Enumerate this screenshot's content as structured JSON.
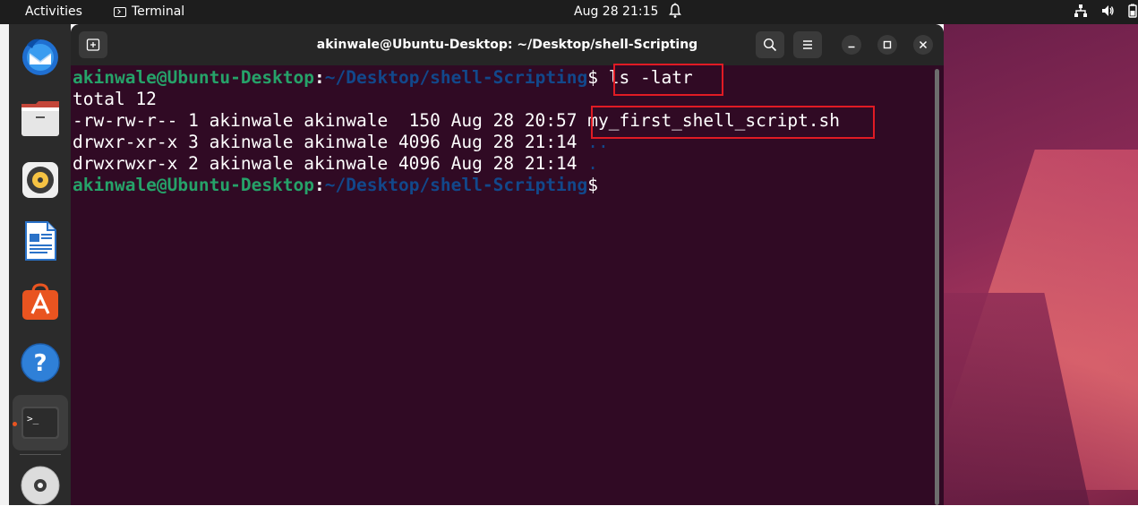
{
  "topbar": {
    "activities": "Activities",
    "app_name": "Terminal",
    "datetime": "Aug 28  21:15"
  },
  "dock": {
    "items": [
      "thunderbird-icon",
      "files-icon",
      "rhythmbox-icon",
      "libreoffice-writer-icon",
      "app-center-icon",
      "help-icon",
      "terminal-icon",
      "disc-icon"
    ],
    "terminal_glyph": ">_"
  },
  "terminal": {
    "title": "akinwale@Ubuntu-Desktop: ~/Desktop/shell-Scripting",
    "prompt_user": "akinwale@Ubuntu-Desktop",
    "prompt_colon": ":",
    "prompt_path": "~/Desktop/shell-Scripting",
    "prompt_dollar": "$",
    "command": " ls -latr",
    "output": {
      "total": "total 12",
      "rows": [
        {
          "meta": "-rw-rw-r-- 1 akinwale akinwale  150 Aug 28 20:57 ",
          "name": "my_first_shell_script.sh"
        },
        {
          "meta": "drwxr-xr-x 3 akinwale akinwale 4096 Aug 28 21:14 ",
          "name": ".."
        },
        {
          "meta": "drwxrwxr-x 2 akinwale akinwale 4096 Aug 28 21:14 ",
          "name": "."
        }
      ]
    }
  },
  "colors": {
    "terminal_bg": "#300a24",
    "prompt_user": "#26a269",
    "prompt_path": "#12488b",
    "highlight_box": "#e01b24",
    "ubuntu_orange": "#e95420"
  }
}
